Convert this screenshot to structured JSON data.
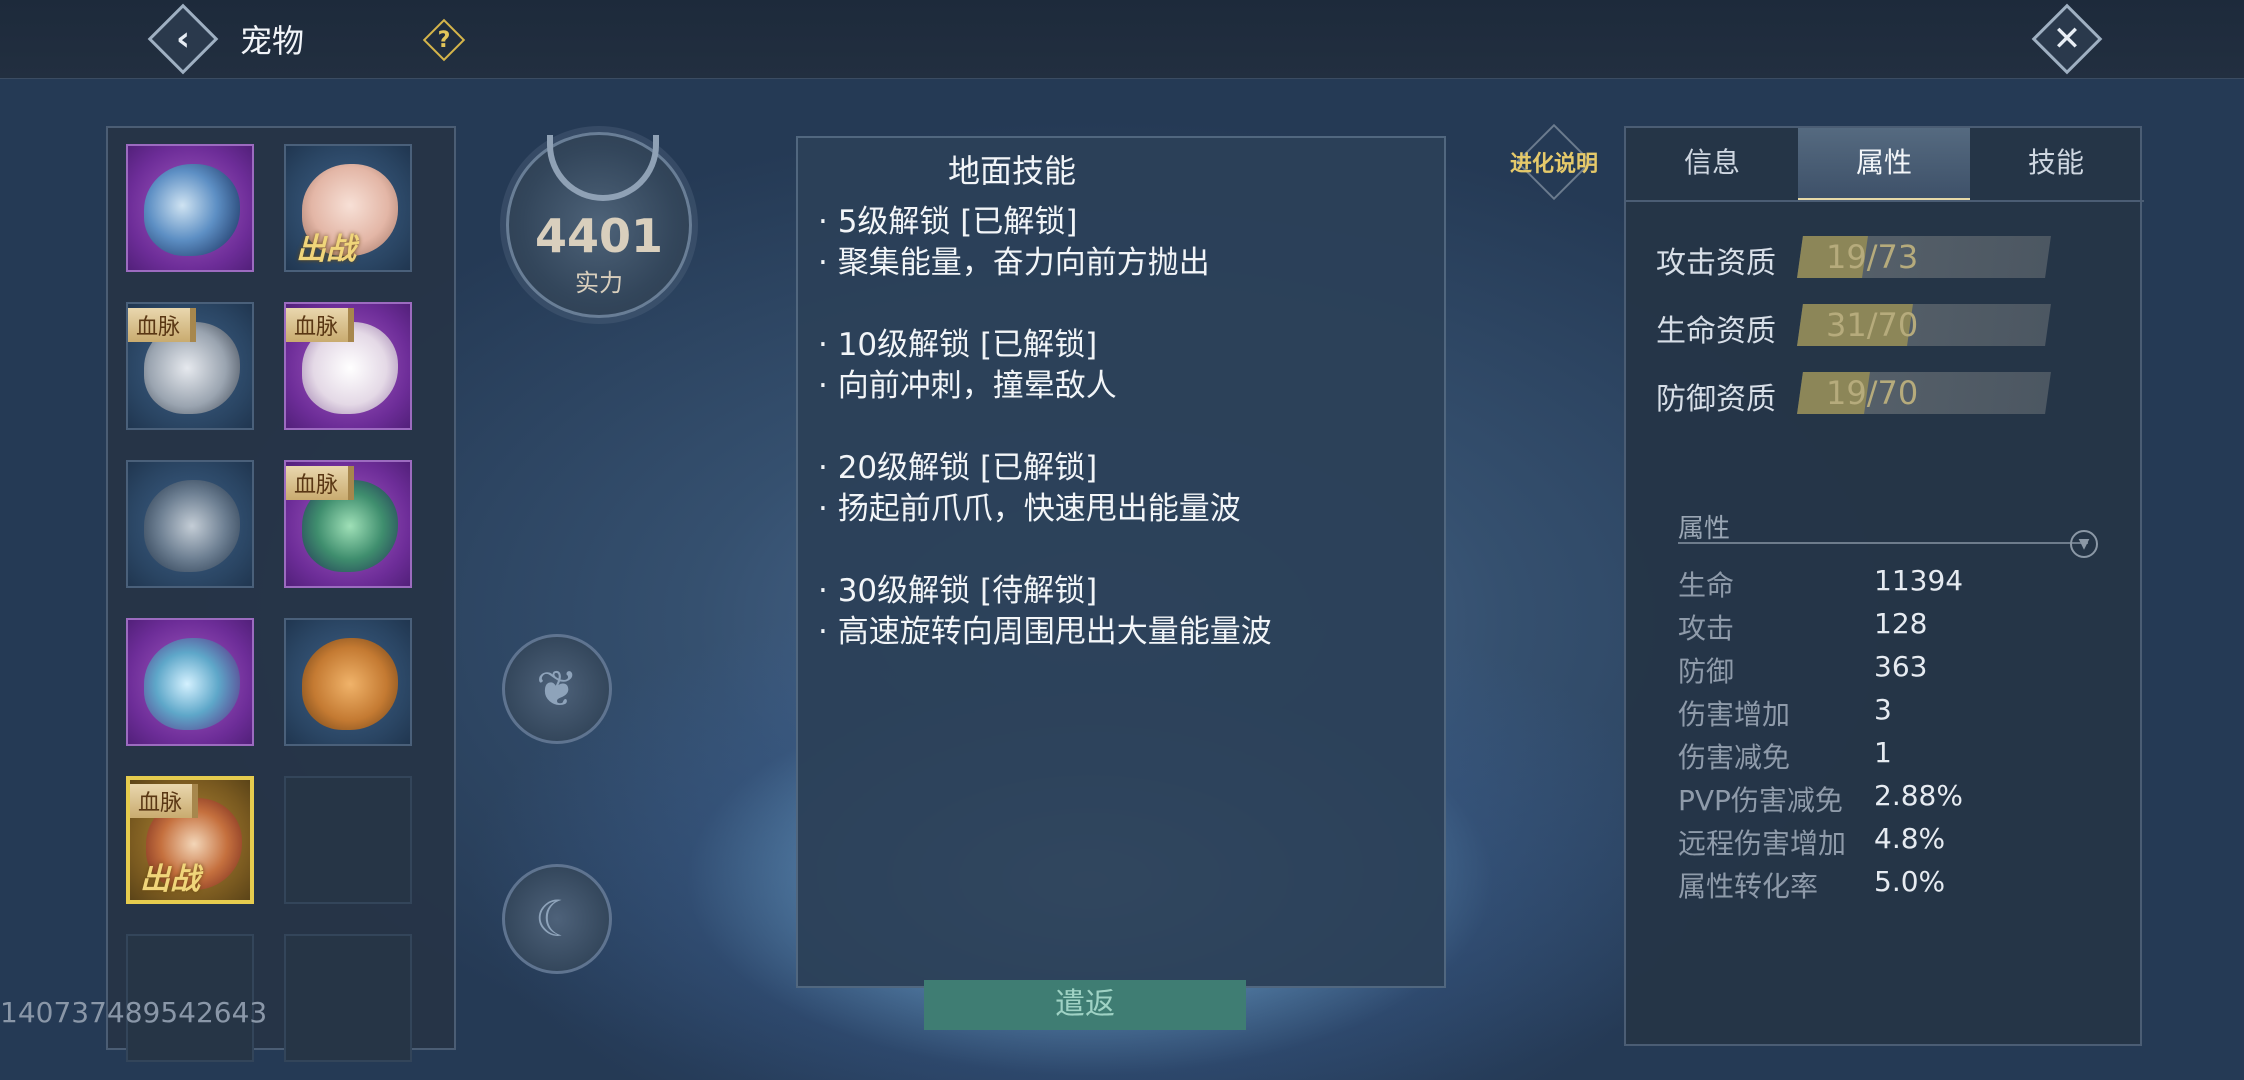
{
  "header": {
    "title": "宠物",
    "back_icon": "back-arrow-icon",
    "help_icon": "question-icon",
    "close_icon": "close-x-icon"
  },
  "pet_list": {
    "slots": [
      {
        "rarity": "purple",
        "tag": "",
        "battle": "",
        "icon": "whale-fish-pet-icon"
      },
      {
        "rarity": "blue",
        "tag": "",
        "battle": "出战",
        "icon": "mouse-pet-icon"
      },
      {
        "rarity": "blue",
        "tag": "血脉",
        "battle": "",
        "icon": "griffin-pet-icon"
      },
      {
        "rarity": "purple",
        "tag": "血脉",
        "battle": "",
        "icon": "white-horse-pet-icon"
      },
      {
        "rarity": "blue",
        "tag": "",
        "battle": "",
        "icon": "shark-pet-icon"
      },
      {
        "rarity": "purple",
        "tag": "血脉",
        "battle": "",
        "icon": "crab-pet-icon"
      },
      {
        "rarity": "purple",
        "tag": "",
        "battle": "",
        "icon": "dragon-pet-icon"
      },
      {
        "rarity": "blue",
        "tag": "",
        "battle": "",
        "icon": "toad-pet-icon"
      },
      {
        "rarity": "gold",
        "tag": "血脉",
        "battle": "出战",
        "icon": "monkey-pet-icon"
      },
      {
        "rarity": "empty",
        "tag": "",
        "battle": "",
        "icon": ""
      },
      {
        "rarity": "empty",
        "tag": "",
        "battle": "",
        "icon": ""
      },
      {
        "rarity": "empty",
        "tag": "",
        "battle": "",
        "icon": ""
      }
    ],
    "uid": "140737489542643"
  },
  "power": {
    "value": "4401",
    "label": "实力"
  },
  "side_icons": {
    "ground": "phoenix-skill-icon",
    "water": "wave-skill-icon"
  },
  "skill_panel": {
    "title": "地面技能",
    "entries": [
      {
        "unlock": "· 5级解锁  [已解锁]",
        "desc": "· 聚集能量，奋力向前方抛出"
      },
      {
        "unlock": "· 10级解锁  [已解锁]",
        "desc": "· 向前冲刺，撞晕敌人"
      },
      {
        "unlock": "· 20级解锁  [已解锁]",
        "desc": "· 扬起前爪爪，快速甩出能量波"
      },
      {
        "unlock": "· 30级解锁  [待解锁]",
        "desc": "· 高速旋转向周围甩出大量能量波"
      }
    ]
  },
  "return_button": "遣返",
  "evolution_button": "进化说明",
  "right_panel": {
    "tabs": [
      {
        "label": "信息",
        "active": false
      },
      {
        "label": "属性",
        "active": true
      },
      {
        "label": "技能",
        "active": false
      }
    ],
    "aptitudes": [
      {
        "label": "攻击资质",
        "text": "19/73",
        "current": 19,
        "max": 73
      },
      {
        "label": "生命资质",
        "text": "31/70",
        "current": 31,
        "max": 70
      },
      {
        "label": "防御资质",
        "text": "19/70",
        "current": 19,
        "max": 70
      }
    ],
    "attributes_header": "属性",
    "attributes": [
      {
        "name": "生命",
        "value": "11394"
      },
      {
        "name": "攻击",
        "value": "128"
      },
      {
        "name": "防御",
        "value": "363"
      },
      {
        "name": "伤害增加",
        "value": "3"
      },
      {
        "name": "伤害减免",
        "value": "1"
      },
      {
        "name": "PVP伤害减免",
        "value": "2.88%"
      },
      {
        "name": "远程伤害增加",
        "value": "4.8%"
      },
      {
        "name": "属性转化率",
        "value": "5.0%"
      }
    ]
  },
  "colors": {
    "accent_gold": "#e2c55a",
    "panel": "#2c4158",
    "return_green": "#3f7d73"
  }
}
